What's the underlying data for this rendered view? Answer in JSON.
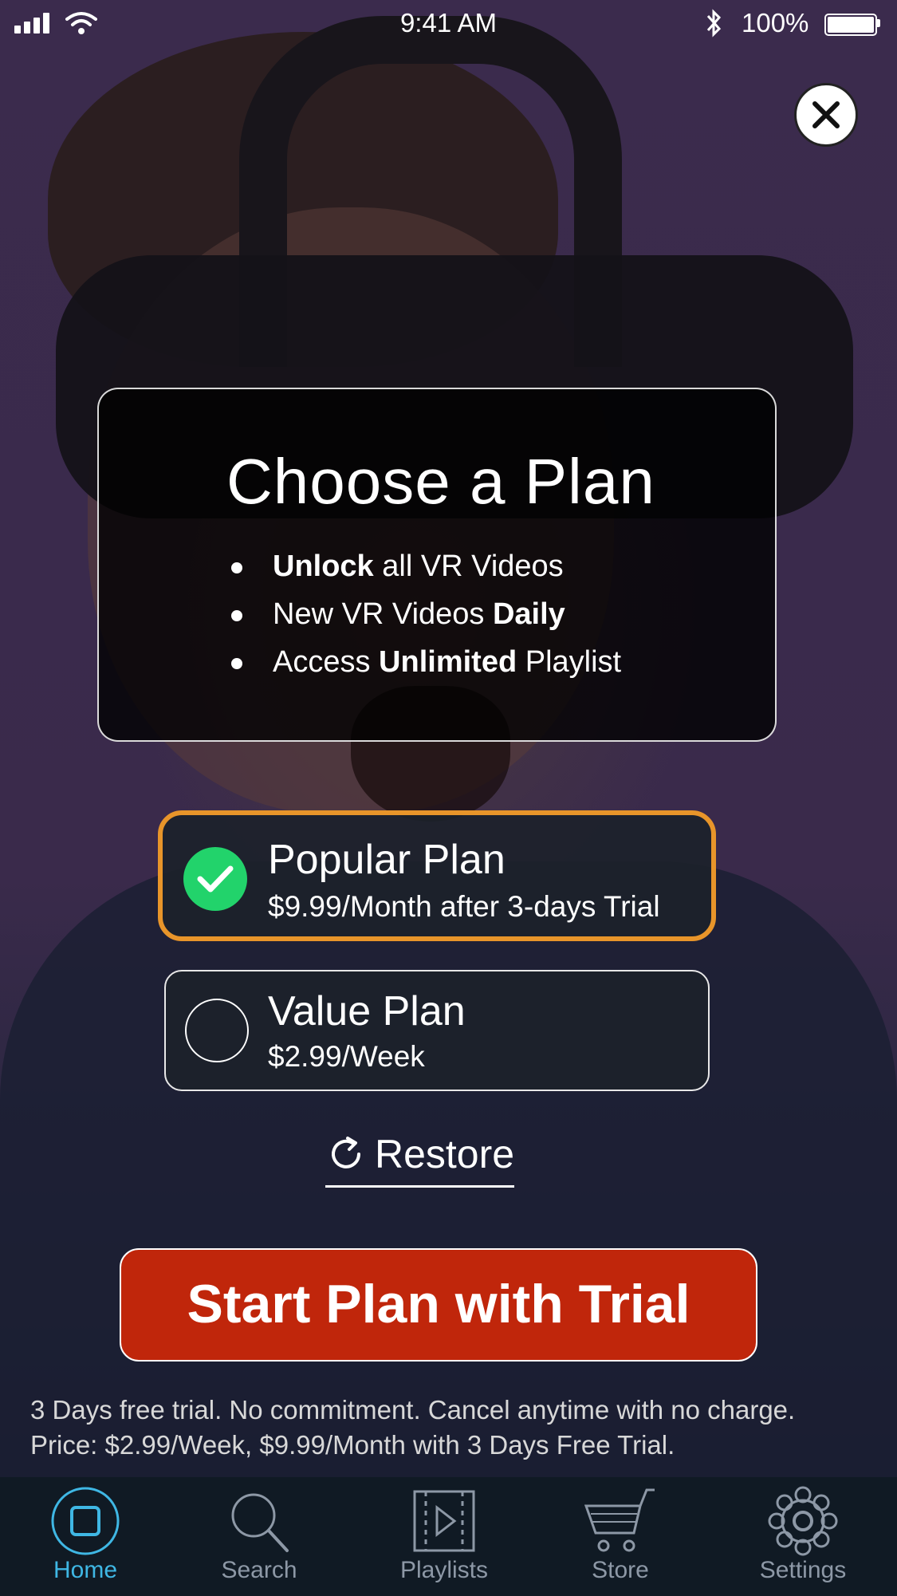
{
  "status_bar": {
    "time": "9:41 AM",
    "battery": "100%"
  },
  "title": "Choose a Plan",
  "features": [
    {
      "pre": "",
      "bold": "Unlock",
      "post": " all VR Videos"
    },
    {
      "pre": "New VR Videos ",
      "bold": "Daily",
      "post": ""
    },
    {
      "pre": "Access ",
      "bold": "Unlimited",
      "post": " Playlist"
    }
  ],
  "plans": [
    {
      "name": "Popular Plan",
      "price": "$9.99/Month after 3-days Trial",
      "selected": true
    },
    {
      "name": "Value Plan",
      "price": "$2.99/Week",
      "selected": false
    }
  ],
  "restore_label": "Restore",
  "cta_label": "Start Plan with Trial",
  "disclaimer": {
    "line1": "3 Days free trial. No commitment. Cancel anytime with no charge.",
    "line2": "Price: $2.99/Week, $9.99/Month with 3 Days Free Trial."
  },
  "tabs": [
    {
      "label": "Home",
      "icon": "home-icon",
      "active": true
    },
    {
      "label": "Search",
      "icon": "search-icon",
      "active": false
    },
    {
      "label": "Playlists",
      "icon": "playlists-icon",
      "active": false
    },
    {
      "label": "Store",
      "icon": "cart-icon",
      "active": false
    },
    {
      "label": "Settings",
      "icon": "gear-icon",
      "active": false
    }
  ],
  "colors": {
    "accent_orange": "#e8952a",
    "check_green": "#22d36b",
    "cta_red": "#c0260b",
    "tab_active": "#3fb7e4"
  }
}
